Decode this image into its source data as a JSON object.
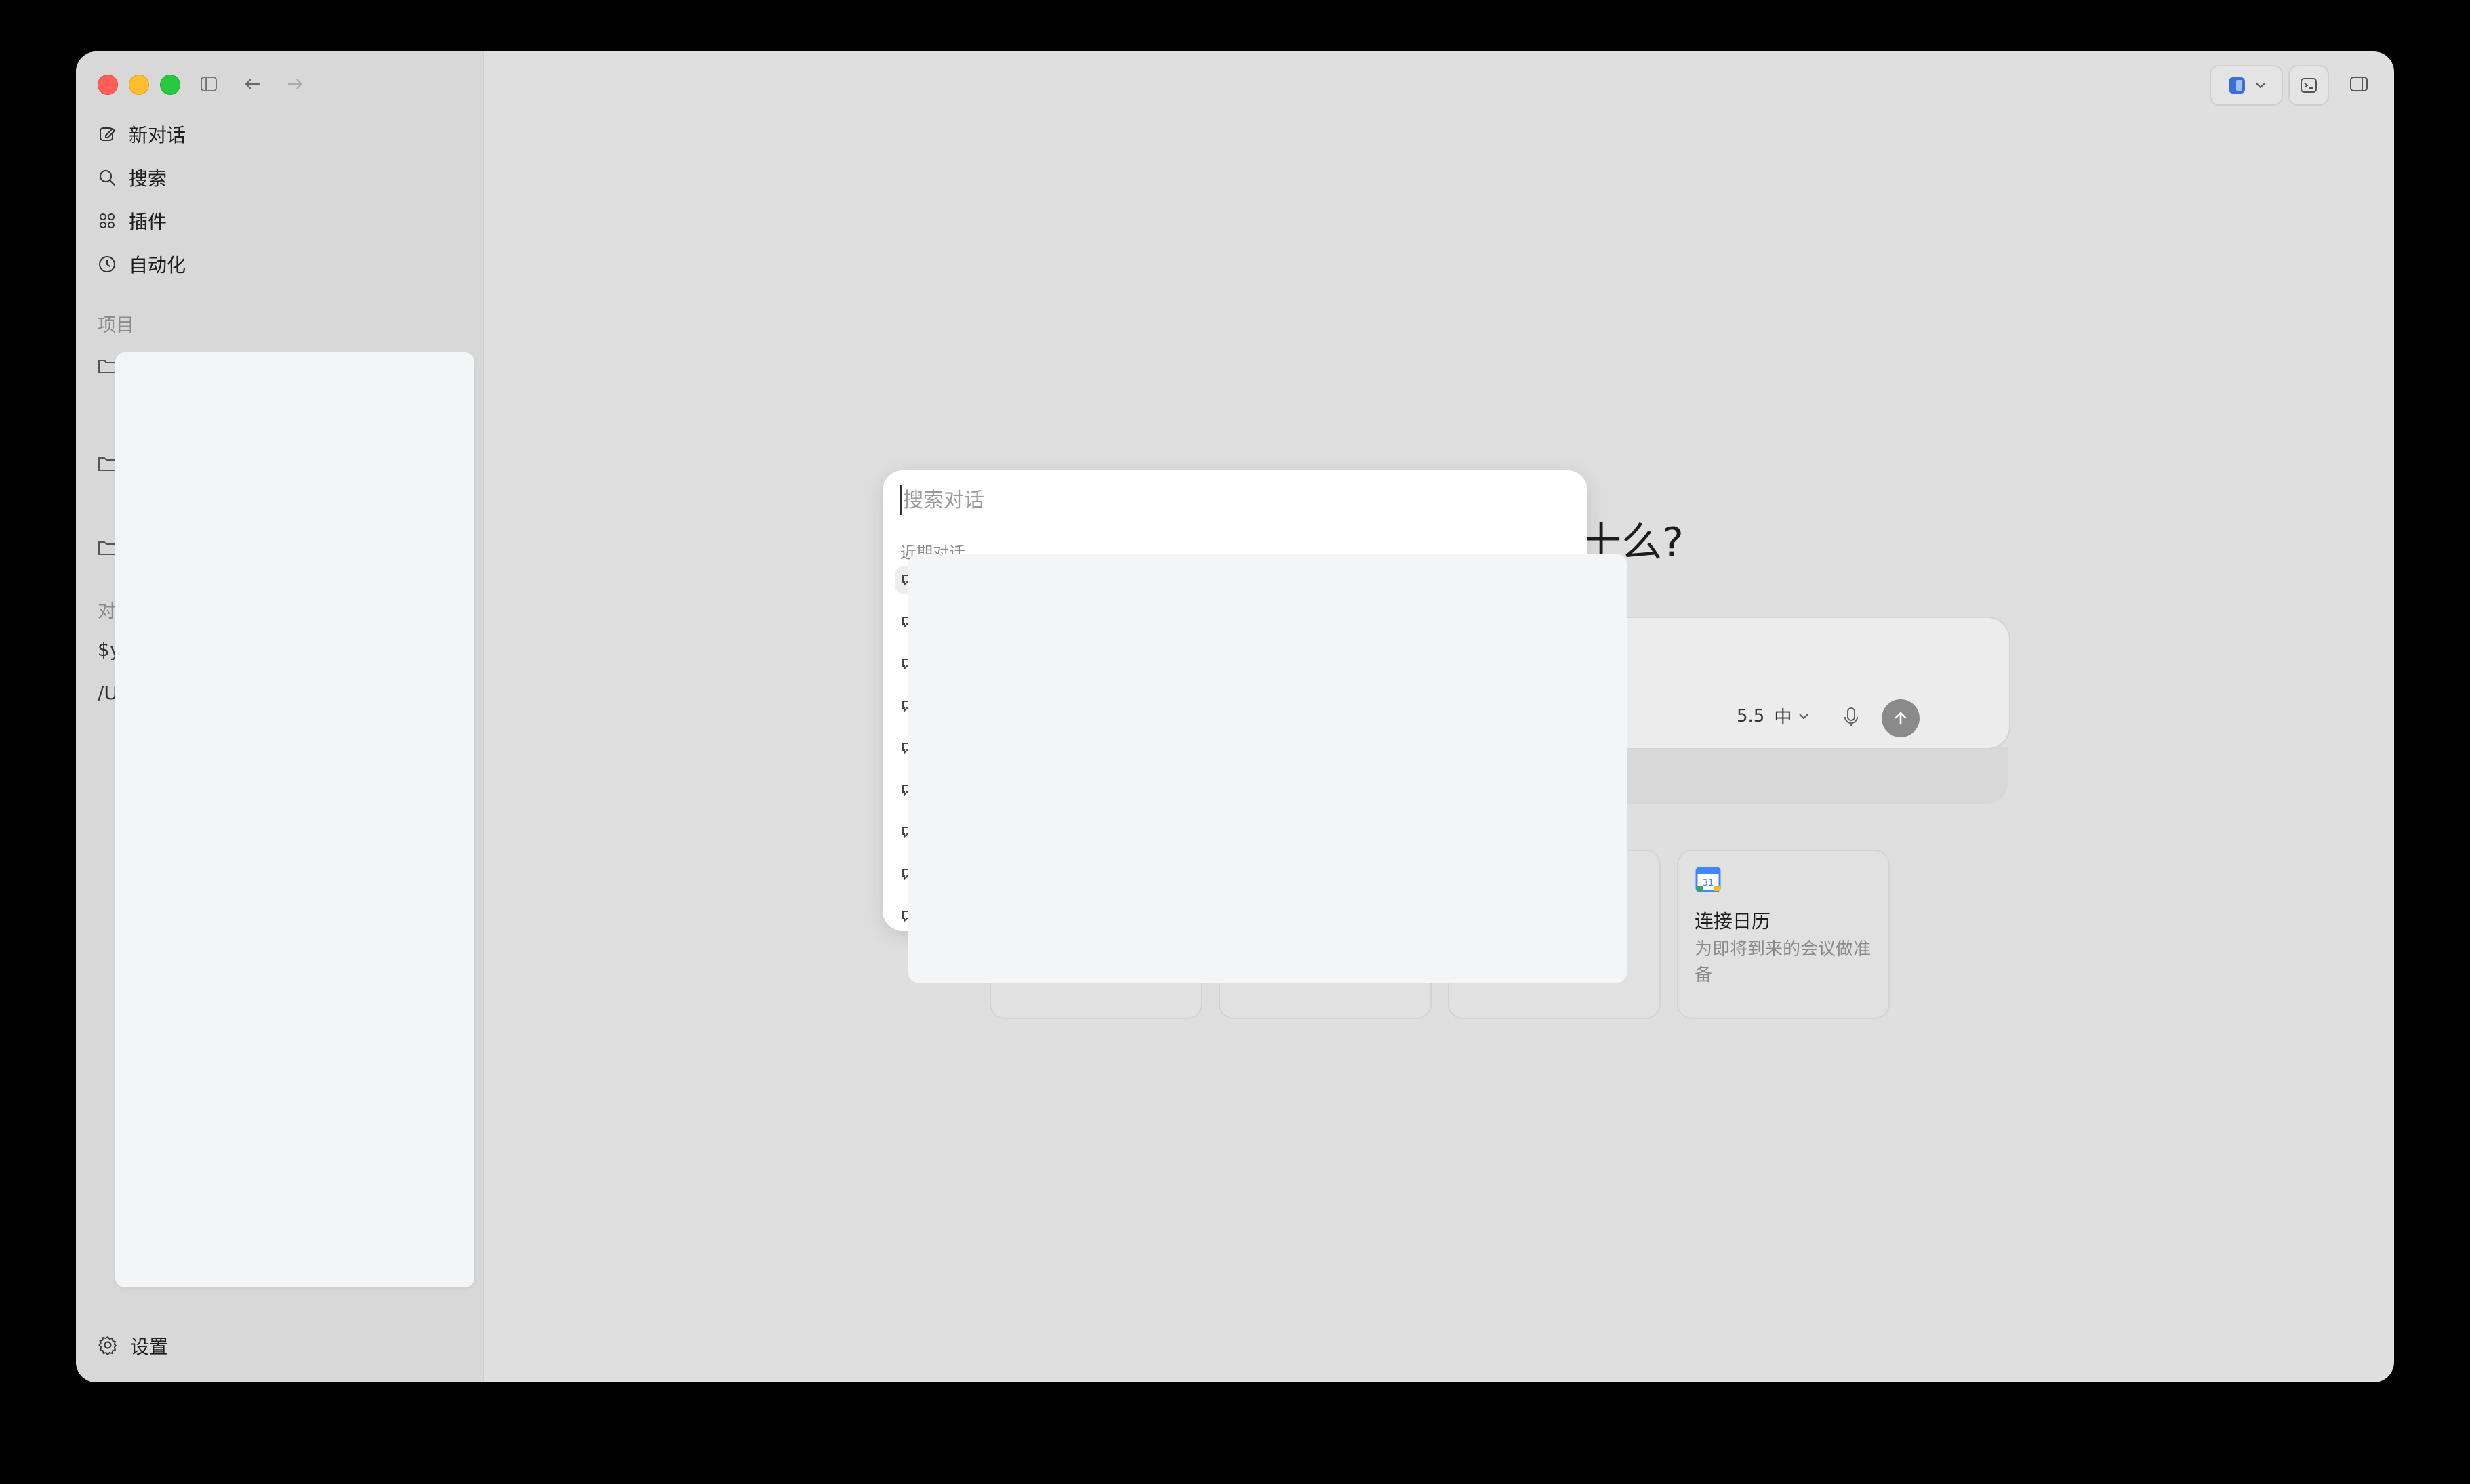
{
  "sidebar": {
    "nav": [
      {
        "label": "新对话",
        "icon": "compose-icon"
      },
      {
        "label": "搜索",
        "icon": "search-icon"
      },
      {
        "label": "插件",
        "icon": "grid-icon"
      },
      {
        "label": "自动化",
        "icon": "clock-icon"
      }
    ],
    "projects_label": "项目",
    "conversations_fragment": "对",
    "items_fragments": [
      "$y",
      "/U"
    ],
    "settings_label": "设置"
  },
  "main": {
    "heading_fragment": "十么?",
    "composer": {
      "model_label": "5.5",
      "effort_label": "中"
    },
    "cards": [
      {
        "title": "连接日历",
        "desc": "为即将到来的会议做准备",
        "icon": "calendar-icon"
      }
    ]
  },
  "search_modal": {
    "placeholder": "搜索对话",
    "value": "",
    "recent_label": "近期对话"
  },
  "colors": {
    "close": "#ff5f57",
    "minimize": "#febc2e",
    "maximize": "#28c840",
    "send_button": "#8a8a8a"
  }
}
